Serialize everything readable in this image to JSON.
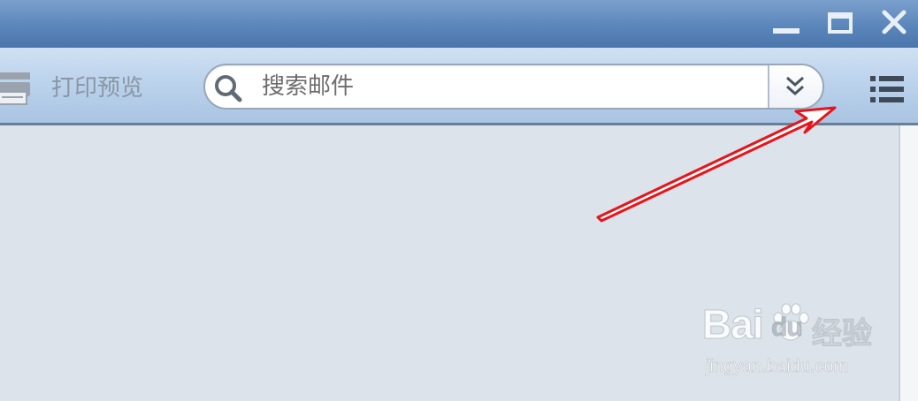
{
  "toolbar": {
    "print_preview_label": "打印预览"
  },
  "search": {
    "placeholder": "搜索邮件"
  },
  "watermark": {
    "brand_left": "Bai",
    "brand_right": "du",
    "brand_suffix": "经验",
    "url": "jingyan.baidu.com"
  },
  "colors": {
    "titlebar": "#5b86bb",
    "toolbar": "#bcd3ec",
    "content_bg": "#dce3ea",
    "arrow": "#e8141c"
  },
  "icons": {
    "window_controls": [
      "minimize-icon",
      "maximize-icon",
      "close-icon"
    ],
    "toolbar": [
      "printer-icon",
      "search-icon",
      "double-chevron-down-icon",
      "list-menu-icon"
    ]
  }
}
